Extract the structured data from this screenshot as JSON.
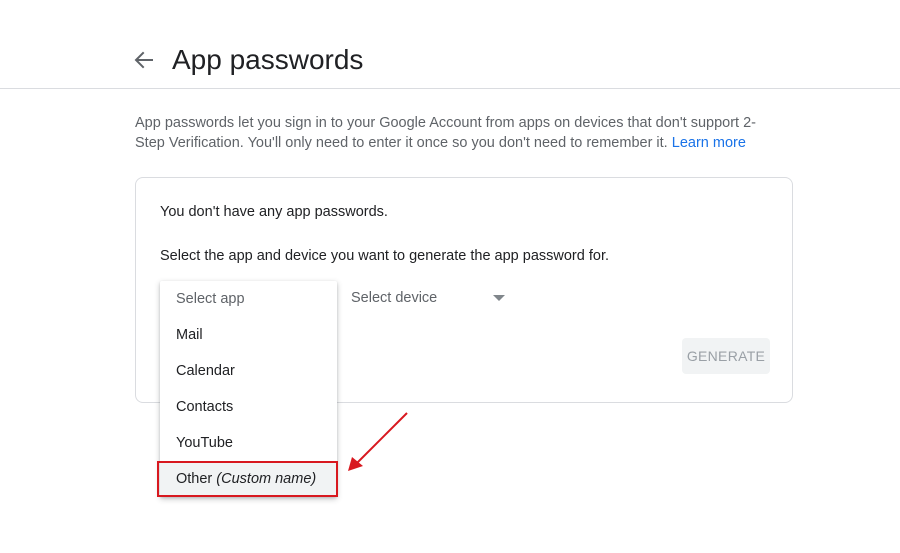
{
  "header": {
    "title": "App passwords",
    "back_icon": "arrow-left-icon"
  },
  "intro": {
    "text": "App passwords let you sign in to your Google Account from apps on devices that don't support 2-Step Verification. You'll only need to enter it once so you don't need to remember it.",
    "link_label": "Learn more"
  },
  "card": {
    "empty_message": "You don't have any app passwords.",
    "instruction": "Select the app and device you want to generate the app password for.",
    "device_select": {
      "placeholder": "Select device"
    },
    "generate_label": "GENERATE"
  },
  "app_dropdown": {
    "placeholder": "Select app",
    "items": [
      {
        "label": "Mail"
      },
      {
        "label": "Calendar"
      },
      {
        "label": "Contacts"
      },
      {
        "label": "YouTube"
      },
      {
        "label": "Other",
        "suffix": "(Custom name)"
      }
    ]
  },
  "annotation": {
    "color": "#d8181f"
  },
  "colors": {
    "link": "#1a73e8",
    "text": "#202124",
    "muted": "#5f6368",
    "border": "#dadce0"
  }
}
